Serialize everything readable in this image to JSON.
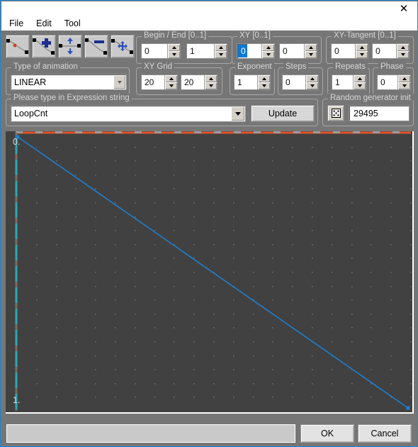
{
  "window": {
    "close_label": "✕"
  },
  "menubar": {
    "items": [
      {
        "label": "File"
      },
      {
        "label": "Edit"
      },
      {
        "label": "Tool"
      }
    ]
  },
  "toolbar": {
    "buttons": [
      {
        "icon": "curve-point-icon",
        "name": "curve-select-point"
      },
      {
        "icon": "curve-add-point-icon",
        "name": "curve-add-point"
      },
      {
        "icon": "curve-vertical-move-icon",
        "name": "curve-move-vertical"
      },
      {
        "icon": "curve-remove-point-icon",
        "name": "curve-remove-point"
      },
      {
        "icon": "curve-move-all-icon",
        "name": "curve-move-all"
      }
    ]
  },
  "groups": {
    "begin_end": {
      "label": "Begin / End [0..1]",
      "begin": "0",
      "end": "1"
    },
    "xy": {
      "label": "XY [0..1]",
      "x": "0",
      "y": "0",
      "x_selected": true
    },
    "xy_tangent": {
      "label": "XY-Tangent [0..1]",
      "x": "0",
      "y": "0"
    },
    "type_of_animation": {
      "label": "Type of animation",
      "value": "LINEAR"
    },
    "xy_grid": {
      "label": "XY Grid",
      "x": "20",
      "y": "20"
    },
    "exponent": {
      "label": "Exponent",
      "value": "1"
    },
    "steps": {
      "label": "Steps",
      "value": "0"
    },
    "repeats": {
      "label": "Repeats",
      "value": "1"
    },
    "phase": {
      "label": "Phase",
      "value": "0"
    },
    "expression": {
      "label": "Please type in Expression string",
      "value": "LoopCnt",
      "update_label": "Update"
    },
    "random": {
      "label": "Random generator init",
      "value": "29495",
      "dice_icon": "dice-icon"
    }
  },
  "graph": {
    "label_top": "0.",
    "label_bottom": "1.",
    "background_color": "#414141",
    "curve_color": "#1f7fd0",
    "top_marker_color": "#e0542a",
    "left_marker_color": "#2aa9b5",
    "grid_dot_color": "#6b6b6b"
  },
  "chart_data": {
    "type": "line",
    "title": "",
    "xlabel": "",
    "ylabel": "",
    "x": [
      0,
      1
    ],
    "y": [
      0,
      1
    ],
    "series": [
      {
        "name": "LINEAR",
        "values": [
          0,
          1
        ]
      }
    ],
    "xlim": [
      0,
      1
    ],
    "ylim": [
      0,
      1
    ],
    "ytick_labels": [
      "0.",
      "1."
    ],
    "grid": true,
    "grid_divisions_x": 20,
    "grid_divisions_y": 20,
    "legend": "none"
  },
  "bottom": {
    "status": "",
    "ok_label": "OK",
    "cancel_label": "Cancel"
  }
}
